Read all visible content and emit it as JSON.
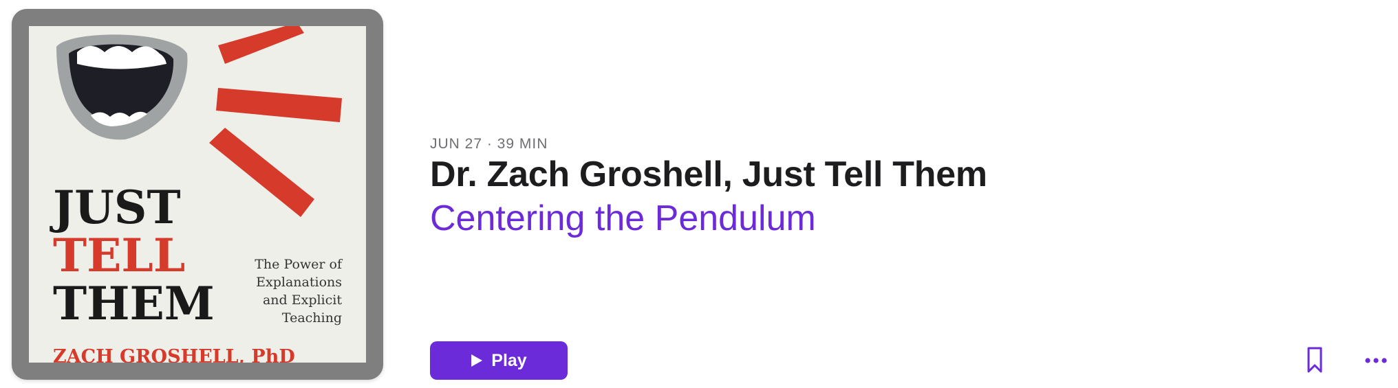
{
  "episode": {
    "meta": "JUN 27 · 39 MIN",
    "title": "Dr. Zach Groshell, Just Tell Them",
    "show": "Centering the Pendulum"
  },
  "artwork": {
    "line1": "JUST",
    "line2": "TELL",
    "line3": "THEM",
    "subtitle1": "The Power of",
    "subtitle2": "Explanations",
    "subtitle3": "and Explicit",
    "subtitle4": "Teaching",
    "author": "ZACH GROSHELL, PhD"
  },
  "actions": {
    "play_label": "Play"
  },
  "colors": {
    "accent": "#6c2bd9",
    "cover_red": "#d63a2b",
    "cover_bg": "#efefea"
  },
  "icons": {
    "play": "play-icon",
    "bookmark": "bookmark-icon",
    "more": "more-icon"
  }
}
